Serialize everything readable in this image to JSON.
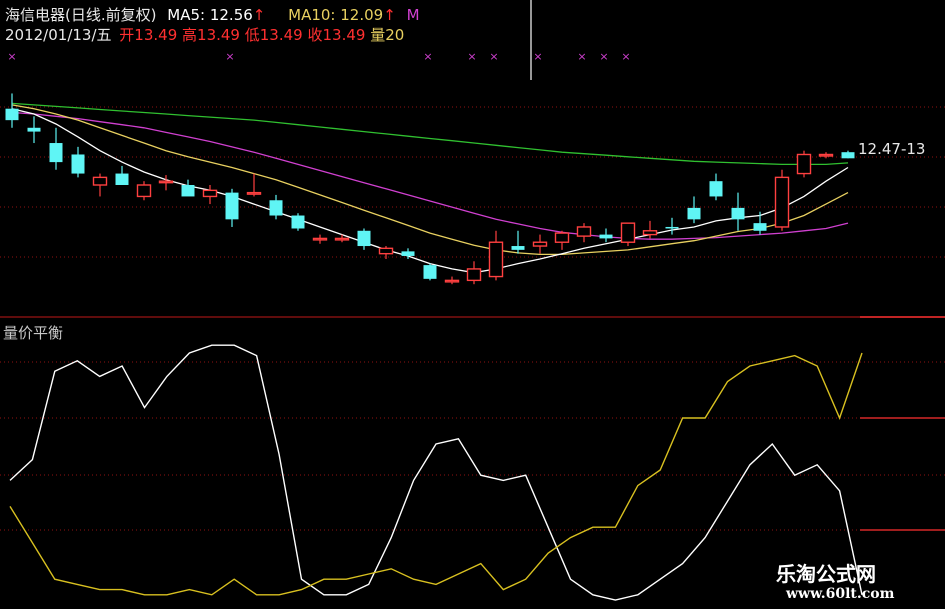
{
  "header": {
    "stock_title": "海信电器(日线.前复权)",
    "ma5_label": "MA5: 12.56",
    "ma5_arrow": "↑",
    "ma10_label": "MA10: 12.09",
    "ma10_arrow": "↑",
    "ma_extra": "M",
    "date": "2012/01/13/五",
    "open": "开13.49",
    "high": "高13.49",
    "low": "低13.49",
    "close": "收13.49",
    "volume": "量20",
    "marker": "×"
  },
  "indicator": {
    "title": "量价平衡"
  },
  "watermark": {
    "line1": "乐淘公式网",
    "line2": "www.60lt.com"
  },
  "colors": {
    "background": "#000000",
    "up_candle": "#ff4040",
    "down_candle": "#5ff5f5",
    "ma5": "#ffffff",
    "ma10": "#e8d060",
    "ma20": "#d040d0",
    "ma60": "#30c030",
    "indicator_white": "#ffffff",
    "indicator_yellow": "#d8c020",
    "grid": "#c01818",
    "marker": "#d040d0"
  },
  "chart_data": [
    {
      "type": "candlestick",
      "last_price_label": "12.47-13",
      "ylim": [
        11.2,
        13.9
      ],
      "candles": [
        {
          "o": 13.55,
          "h": 13.75,
          "l": 13.3,
          "c": 13.4
        },
        {
          "o": 13.3,
          "h": 13.45,
          "l": 13.1,
          "c": 13.25
        },
        {
          "o": 13.1,
          "h": 13.3,
          "l": 12.75,
          "c": 12.85
        },
        {
          "o": 12.95,
          "h": 13.05,
          "l": 12.65,
          "c": 12.7
        },
        {
          "o": 12.55,
          "h": 12.7,
          "l": 12.4,
          "c": 12.65
        },
        {
          "o": 12.7,
          "h": 12.8,
          "l": 12.55,
          "c": 12.55
        },
        {
          "o": 12.4,
          "h": 12.6,
          "l": 12.35,
          "c": 12.55
        },
        {
          "o": 12.6,
          "h": 12.68,
          "l": 12.48,
          "c": 12.6
        },
        {
          "o": 12.55,
          "h": 12.62,
          "l": 12.45,
          "c": 12.4
        },
        {
          "o": 12.4,
          "h": 12.55,
          "l": 12.3,
          "c": 12.48
        },
        {
          "o": 12.45,
          "h": 12.5,
          "l": 12.0,
          "c": 12.1
        },
        {
          "o": 12.45,
          "h": 12.7,
          "l": 12.4,
          "c": 12.45
        },
        {
          "o": 12.35,
          "h": 12.42,
          "l": 12.1,
          "c": 12.15
        },
        {
          "o": 12.15,
          "h": 12.18,
          "l": 11.95,
          "c": 11.98
        },
        {
          "o": 11.85,
          "h": 11.9,
          "l": 11.78,
          "c": 11.85
        },
        {
          "o": 11.85,
          "h": 11.9,
          "l": 11.8,
          "c": 11.85
        },
        {
          "o": 11.95,
          "h": 11.98,
          "l": 11.7,
          "c": 11.75
        },
        {
          "o": 11.65,
          "h": 11.75,
          "l": 11.58,
          "c": 11.72
        },
        {
          "o": 11.68,
          "h": 11.72,
          "l": 11.58,
          "c": 11.62
        },
        {
          "o": 11.5,
          "h": 11.52,
          "l": 11.3,
          "c": 11.32
        },
        {
          "o": 11.3,
          "h": 11.35,
          "l": 11.25,
          "c": 11.3
        },
        {
          "o": 11.3,
          "h": 11.55,
          "l": 11.25,
          "c": 11.45
        },
        {
          "o": 11.35,
          "h": 11.95,
          "l": 11.3,
          "c": 11.8
        },
        {
          "o": 11.75,
          "h": 11.95,
          "l": 11.65,
          "c": 11.7
        },
        {
          "o": 11.75,
          "h": 11.9,
          "l": 11.65,
          "c": 11.8
        },
        {
          "o": 11.8,
          "h": 11.95,
          "l": 11.7,
          "c": 11.92
        },
        {
          "o": 11.88,
          "h": 12.05,
          "l": 11.8,
          "c": 12.0
        },
        {
          "o": 11.9,
          "h": 11.98,
          "l": 11.8,
          "c": 11.85
        },
        {
          "o": 11.8,
          "h": 12.05,
          "l": 11.75,
          "c": 12.05
        },
        {
          "o": 11.9,
          "h": 12.08,
          "l": 11.85,
          "c": 11.95
        },
        {
          "o": 12.0,
          "h": 12.12,
          "l": 11.9,
          "c": 11.98
        },
        {
          "o": 12.25,
          "h": 12.4,
          "l": 12.05,
          "c": 12.1
        },
        {
          "o": 12.6,
          "h": 12.7,
          "l": 12.35,
          "c": 12.4
        },
        {
          "o": 12.25,
          "h": 12.45,
          "l": 11.95,
          "c": 12.1
        },
        {
          "o": 12.05,
          "h": 12.2,
          "l": 11.9,
          "c": 11.95
        },
        {
          "o": 12.0,
          "h": 12.75,
          "l": 11.95,
          "c": 12.65
        },
        {
          "o": 12.7,
          "h": 13.0,
          "l": 12.65,
          "c": 12.95
        },
        {
          "o": 12.95,
          "h": 12.98,
          "l": 12.9,
          "c": 12.95
        },
        {
          "o": 12.98,
          "h": 13.0,
          "l": 12.9,
          "c": 12.9
        }
      ],
      "ma_series": {
        "ma5": [
          13.55,
          13.48,
          13.35,
          13.18,
          13.0,
          12.85,
          12.72,
          12.62,
          12.54,
          12.48,
          12.4,
          12.3,
          12.2,
          12.1,
          12.0,
          11.9,
          11.8,
          11.7,
          11.62,
          11.52,
          11.45,
          11.4,
          11.45,
          11.52,
          11.58,
          11.65,
          11.72,
          11.78,
          11.84,
          11.9,
          11.96,
          12.0,
          12.08,
          12.12,
          12.15,
          12.25,
          12.4,
          12.6,
          12.78
        ],
        "ma10": [
          13.6,
          13.55,
          13.48,
          13.4,
          13.3,
          13.2,
          13.1,
          13.0,
          12.92,
          12.85,
          12.78,
          12.7,
          12.62,
          12.52,
          12.42,
          12.32,
          12.22,
          12.12,
          12.02,
          11.92,
          11.84,
          11.76,
          11.7,
          11.66,
          11.64,
          11.64,
          11.66,
          11.68,
          11.7,
          11.74,
          11.78,
          11.82,
          11.88,
          11.94,
          11.98,
          12.05,
          12.15,
          12.3,
          12.45
        ],
        "ma20": [
          13.5,
          13.48,
          13.45,
          13.42,
          13.38,
          13.34,
          13.3,
          13.24,
          13.18,
          13.12,
          13.05,
          12.98,
          12.9,
          12.82,
          12.74,
          12.66,
          12.58,
          12.5,
          12.42,
          12.34,
          12.26,
          12.18,
          12.1,
          12.04,
          11.98,
          11.93,
          11.9,
          11.87,
          11.85,
          11.84,
          11.84,
          11.85,
          11.86,
          11.88,
          11.9,
          11.92,
          11.95,
          11.98,
          12.05
        ],
        "ma60": [
          13.62,
          13.6,
          13.58,
          13.56,
          13.54,
          13.52,
          13.5,
          13.48,
          13.46,
          13.44,
          13.42,
          13.4,
          13.37,
          13.34,
          13.31,
          13.28,
          13.25,
          13.22,
          13.19,
          13.16,
          13.13,
          13.1,
          13.07,
          13.04,
          13.01,
          12.98,
          12.96,
          12.94,
          12.92,
          12.9,
          12.88,
          12.86,
          12.85,
          12.84,
          12.83,
          12.82,
          12.82,
          12.82,
          12.84
        ]
      },
      "markers_on_candles": [
        0,
        9,
        11,
        12,
        14,
        16,
        17,
        18
      ]
    },
    {
      "type": "line",
      "title": "量价平衡",
      "ylim": [
        0,
        100
      ],
      "series": [
        {
          "color": "white",
          "values": [
            46,
            54,
            88,
            92,
            86,
            90,
            74,
            86,
            95,
            98,
            98,
            94,
            56,
            8,
            2,
            2,
            6,
            24,
            46,
            60,
            62,
            48,
            46,
            48,
            28,
            8,
            2,
            0,
            2,
            8,
            14,
            24,
            38,
            52,
            60,
            48,
            52,
            42,
            2
          ]
        },
        {
          "color": "yellow",
          "values": [
            36,
            22,
            8,
            6,
            4,
            4,
            2,
            2,
            4,
            2,
            8,
            2,
            2,
            4,
            8,
            8,
            10,
            12,
            8,
            6,
            10,
            14,
            4,
            8,
            18,
            24,
            28,
            28,
            44,
            50,
            70,
            70,
            84,
            90,
            92,
            94,
            90,
            70,
            95
          ]
        }
      ]
    }
  ]
}
